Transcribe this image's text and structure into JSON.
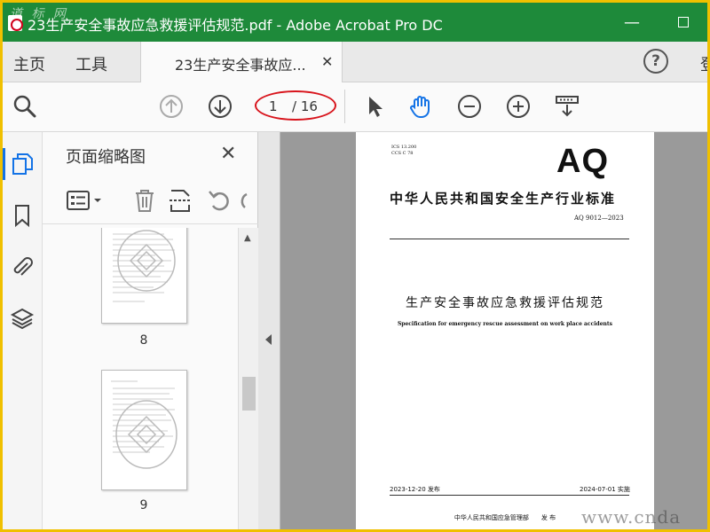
{
  "window": {
    "title": "23生产安全事故应急救援评估规范.pdf - Adobe Acrobat Pro DC",
    "minimize": "—",
    "watermark_top": "道 标 网"
  },
  "menubar": {
    "home": "主页",
    "tools": "工具",
    "tab_label": "23生产安全事故应...",
    "tab_close": "✕",
    "help": "?",
    "signin": "登"
  },
  "toolbar": {
    "page_current": "1",
    "page_total": "/ 16"
  },
  "panel": {
    "title": "页面缩略图",
    "close": "✕",
    "thumbnails": [
      {
        "number": "8"
      },
      {
        "number": "9"
      }
    ]
  },
  "document": {
    "ics": "ICS 13.200",
    "ccs": "CCS C 78",
    "logo": "AQ",
    "standard_line": "中华人民共和国安全生产行业标准",
    "code": "AQ 9012—2023",
    "title_cn": "生产安全事故应急救援评估规范",
    "title_en": "Specification for emergency rescue assessment on work place accidents",
    "publish": "2023-12-20 发布",
    "implement": "2024-07-01 实施",
    "issuer": "中华人民共和国应急管理部　　发 布"
  },
  "watermark_bottom": "www.cnda",
  "colors": {
    "titlebar": "#1e8a3a",
    "accent": "#1473e6",
    "highlight_ring": "#d8141c",
    "frame_border": "#f0c000"
  }
}
